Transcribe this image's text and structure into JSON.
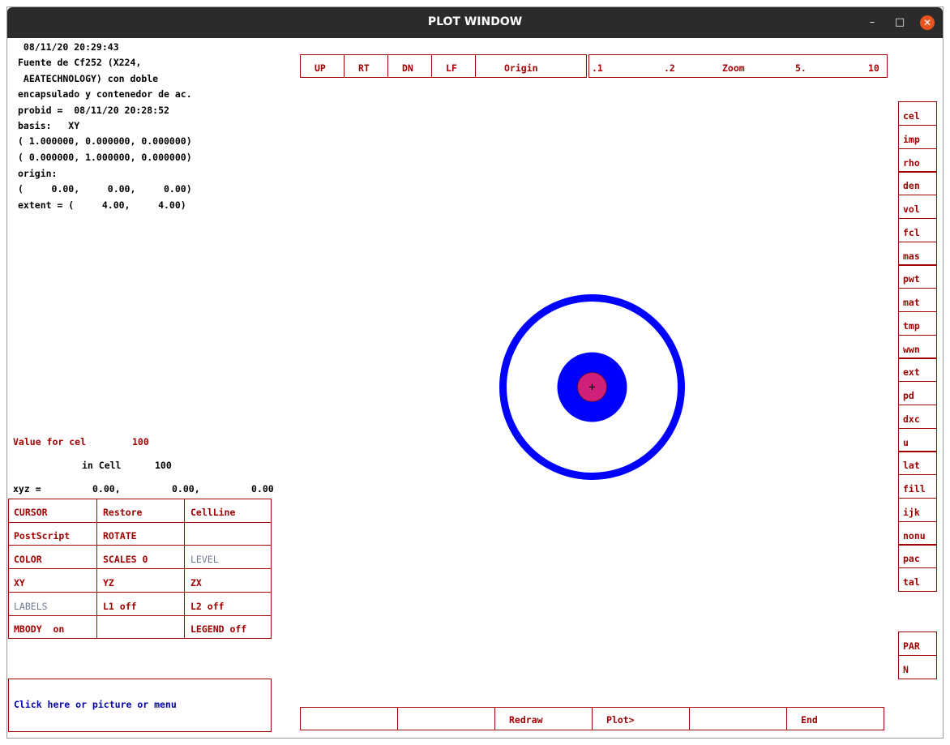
{
  "window": {
    "title": "PLOT WINDOW",
    "minimize": "–",
    "maximize": "□",
    "close": "✕"
  },
  "info": {
    "lines": [
      " 08/11/20 20:29:43",
      "Fuente de Cf252 (X224,",
      " AEATECHNOLOGY) con doble",
      "encapsulado y contenedor de ac.",
      "probid =  08/11/20 20:28:52",
      "basis:   XY",
      "( 1.000000, 0.000000, 0.000000)",
      "( 0.000000, 1.000000, 0.000000)",
      "origin:",
      "(     0.00,     0.00,     0.00)",
      "extent = (     4.00,     4.00)"
    ]
  },
  "value": {
    "label": "Value for cel",
    "value": "100"
  },
  "incell": {
    "label": "in Cell",
    "value": "100"
  },
  "xyz": {
    "label": "xyz =",
    "x": "0.00,",
    "y": "0.00,",
    "z": "0.00"
  },
  "menu": [
    [
      "CURSOR",
      "Restore",
      "CellLine"
    ],
    [
      "PostScript",
      "ROTATE",
      ""
    ],
    [
      "COLOR",
      "SCALES 0",
      "LEVEL"
    ],
    [
      "XY",
      "YZ",
      "ZX"
    ],
    [
      "LABELS",
      "L1 off",
      "L2 off"
    ],
    [
      "MBODY  on",
      "",
      "LEGEND off"
    ]
  ],
  "prompt": "Click here or picture or menu",
  "nav": [
    "UP",
    "RT",
    "DN",
    "LF",
    "Origin"
  ],
  "zoom": {
    "v1": ".1",
    "v2": ".2",
    "label": "Zoom",
    "v3": "5.",
    "v4": "10"
  },
  "side": [
    "cel",
    "imp",
    "rho",
    "den",
    "vol",
    "fcl",
    "mas",
    "pwt",
    "mat",
    "tmp",
    "wwn",
    "ext",
    "pd",
    "dxc",
    "u",
    "lat",
    "fill",
    "ijk",
    "nonu",
    "pac",
    "tal"
  ],
  "side2": [
    "PAR",
    "N"
  ],
  "bottom": [
    "",
    "",
    "Redraw",
    "Plot>",
    "",
    "End"
  ],
  "plot": {
    "ring_color": "#0000ff",
    "core_color": "#d0207a",
    "crosshair": "+"
  }
}
